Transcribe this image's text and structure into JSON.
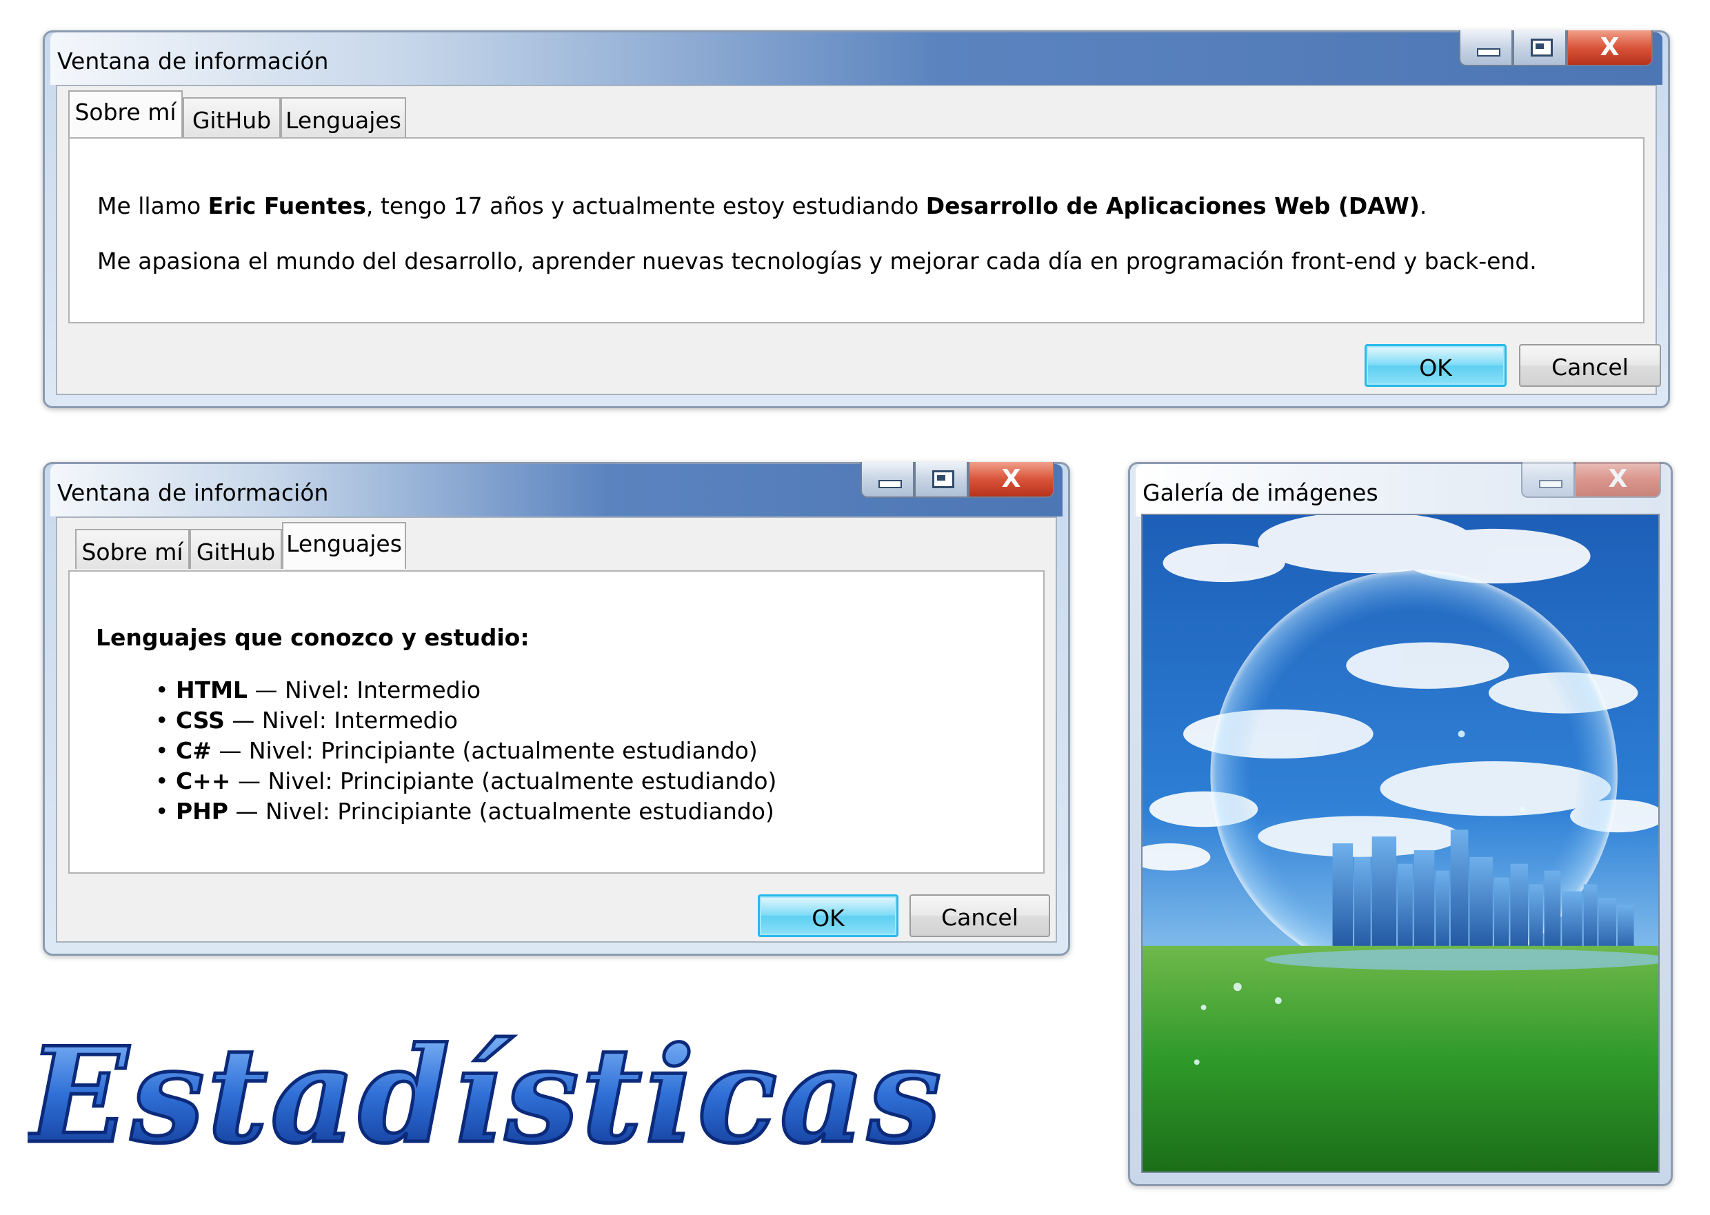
{
  "window1": {
    "title": "Ventana de información",
    "tabs": [
      "Sobre mí",
      "GitHub",
      "Lenguajes"
    ],
    "active_tab": "Sobre mí",
    "about": {
      "line1_pre": "Me llamo ",
      "name": "Eric Fuentes",
      "line1_mid": ", tengo 17 años y actualmente estoy estudiando ",
      "course": "Desarrollo de Aplicaciones Web (DAW)",
      "line1_end": ".",
      "line2": "Me apasiona el mundo del desarrollo, aprender nuevas tecnologías y mejorar cada día en programación front-end y back-end."
    },
    "ok_label": "OK",
    "cancel_label": "Cancel"
  },
  "window2": {
    "title": "Ventana de información",
    "tabs": [
      "Sobre mí",
      "GitHub",
      "Lenguajes"
    ],
    "active_tab": "Lenguajes",
    "heading": "Lenguajes que conozco y estudio:",
    "languages": [
      {
        "bullet": "•",
        "name": "HTML",
        "detail": " — Nivel: Intermedio"
      },
      {
        "bullet": "•",
        "name": "CSS",
        "detail": " — Nivel: Intermedio"
      },
      {
        "bullet": "•",
        "name": "C#",
        "detail": " — Nivel: Principiante (actualmente estudiando)"
      },
      {
        "bullet": "•",
        "name": "C++",
        "detail": " — Nivel: Principiante (actualmente estudiando)"
      },
      {
        "bullet": "•",
        "name": "PHP",
        "detail": " — Nivel: Principiante (actualmente estudiando)"
      }
    ],
    "ok_label": "OK",
    "cancel_label": "Cancel"
  },
  "gallery": {
    "title": "Galería de imágenes"
  },
  "logo": {
    "text": "Estadísticas"
  },
  "colors": {
    "titlebar_blue": "#4c76b4",
    "ok_cyan": "#27b9ea",
    "logo_blue": "#2f6fd6"
  }
}
